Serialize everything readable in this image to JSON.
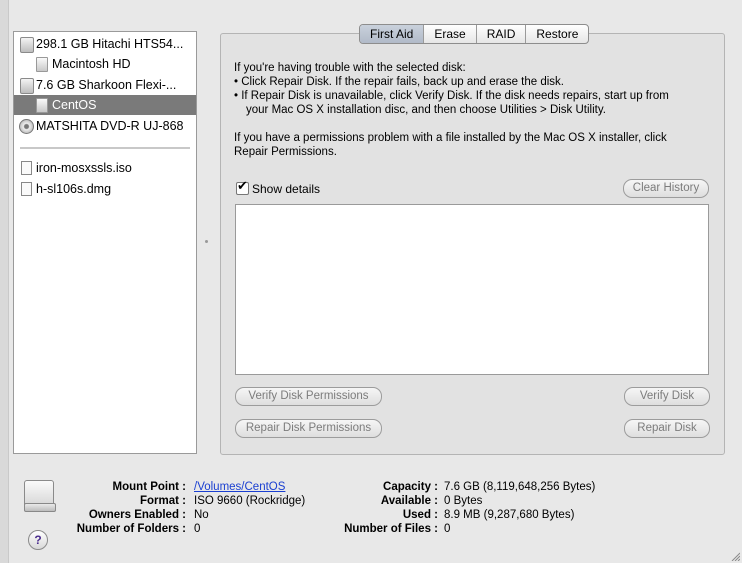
{
  "sidebar": {
    "items": [
      {
        "label": "298.1 GB Hitachi HTS54...",
        "icon": "hard-disk-icon"
      },
      {
        "label": "Macintosh HD",
        "icon": "volume-icon"
      },
      {
        "label": "7.6 GB Sharkoon Flexi-...",
        "icon": "hard-disk-icon"
      },
      {
        "label": "CentOS",
        "icon": "volume-icon",
        "selected": true
      },
      {
        "label": "MATSHITA DVD-R UJ-868",
        "icon": "dvd-drive-icon"
      },
      {
        "label": "iron-mosxssls.iso",
        "icon": "disk-image-icon"
      },
      {
        "label": "h-sl106s.dmg",
        "icon": "disk-image-icon"
      }
    ]
  },
  "tabs": [
    "First Aid",
    "Erase",
    "RAID",
    "Restore"
  ],
  "active_tab": "First Aid",
  "first_aid": {
    "intro": "If you're having trouble with the selected disk:",
    "bullet1": "• Click Repair Disk. If the repair fails, back up and erase the disk.",
    "bullet2a": "• If Repair Disk is unavailable, click Verify Disk. If the disk needs repairs, start up from",
    "bullet2b": "your Mac OS X installation disc, and then choose Utilities > Disk Utility.",
    "perm1": "If you have a permissions problem with a file installed by the Mac OS X installer, click",
    "perm2": "Repair Permissions.",
    "show_details": "Show details",
    "show_details_checked": true,
    "clear_history": "Clear History",
    "verify_permissions": "Verify Disk Permissions",
    "repair_permissions": "Repair Disk Permissions",
    "verify_disk": "Verify Disk",
    "repair_disk": "Repair Disk"
  },
  "info": {
    "mount_point_label": "Mount Point :",
    "mount_point": "/Volumes/CentOS",
    "format_label": "Format :",
    "format": "ISO 9660 (Rockridge)",
    "owners_label": "Owners Enabled :",
    "owners": "No",
    "folders_label": "Number of Folders :",
    "folders": "0",
    "capacity_label": "Capacity :",
    "capacity": "7.6 GB (8,119,648,256 Bytes)",
    "available_label": "Available :",
    "available": "0 Bytes",
    "used_label": "Used :",
    "used": "8.9 MB (9,287,680 Bytes)",
    "files_label": "Number of Files :",
    "files": "0"
  },
  "help_symbol": "?",
  "colors": {
    "selection": "#7a7a7a",
    "link": "#1a3fd1",
    "help_glyph": "#4b2d8e"
  }
}
